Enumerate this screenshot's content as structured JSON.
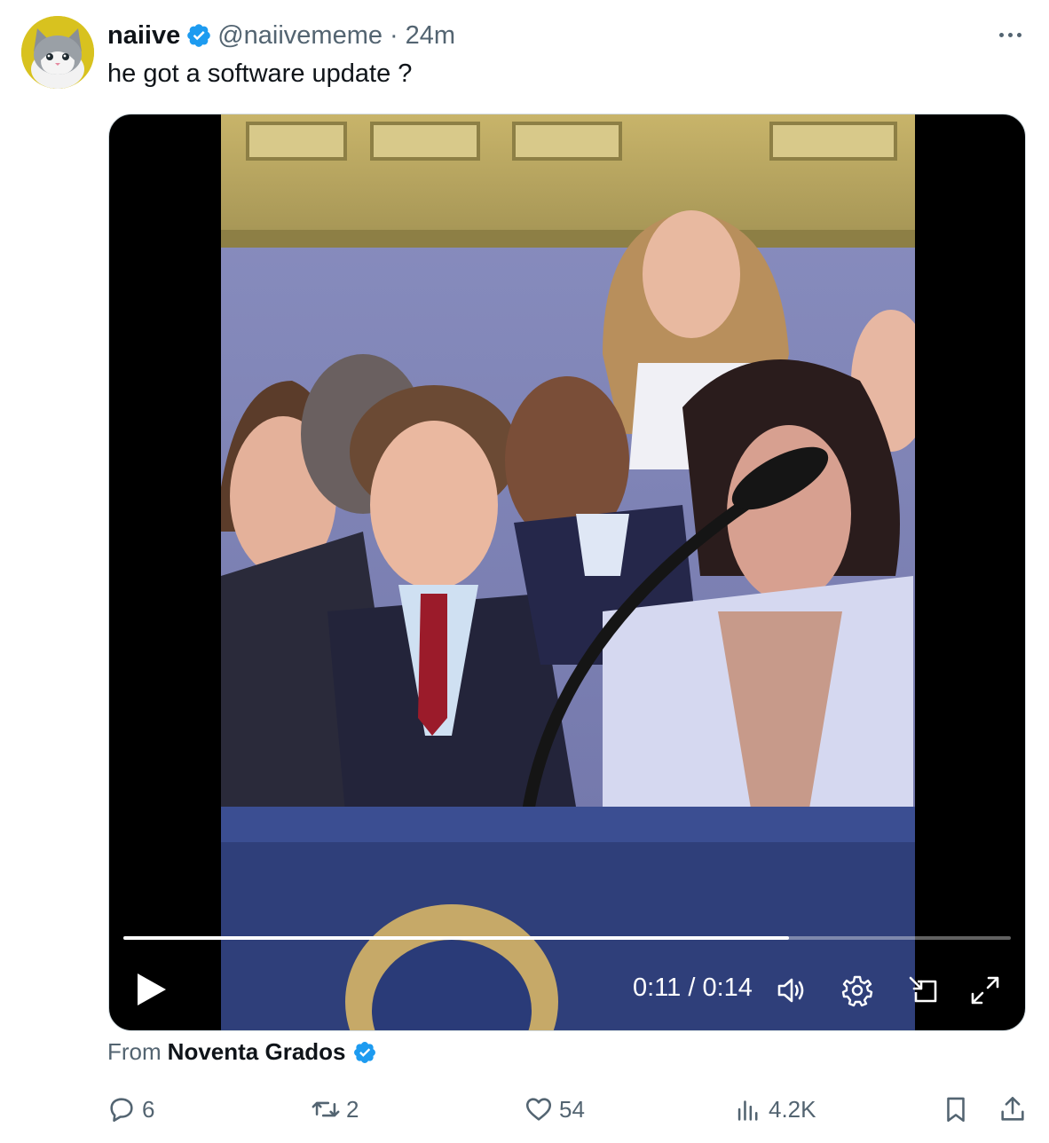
{
  "tweet": {
    "author": {
      "display_name": "naiive",
      "handle": "@naiivememe",
      "verified": true,
      "avatar_icon": "cat-avatar-icon"
    },
    "separator": "·",
    "time": "24m",
    "text": "he got a software update ?",
    "more_icon": "more-horizontal-icon"
  },
  "media": {
    "type": "video",
    "progress": 0.75,
    "time_display": "0:11 / 0:14",
    "controls": {
      "play_icon": "play-icon",
      "volume_icon": "volume-icon",
      "settings_icon": "settings-gear-icon",
      "pip_icon": "picture-in-picture-icon",
      "fullscreen_icon": "fullscreen-icon"
    }
  },
  "source": {
    "label": "From",
    "name": "Noventa Grados",
    "verified": true
  },
  "actions": {
    "reply_count": "6",
    "repost_count": "2",
    "like_count": "54",
    "view_count": "4.2K"
  },
  "colors": {
    "verified_blue": "#1d9bf0",
    "secondary_text": "#536471",
    "primary_text": "#0f1419",
    "avatar_bg": "#d8c21f"
  }
}
